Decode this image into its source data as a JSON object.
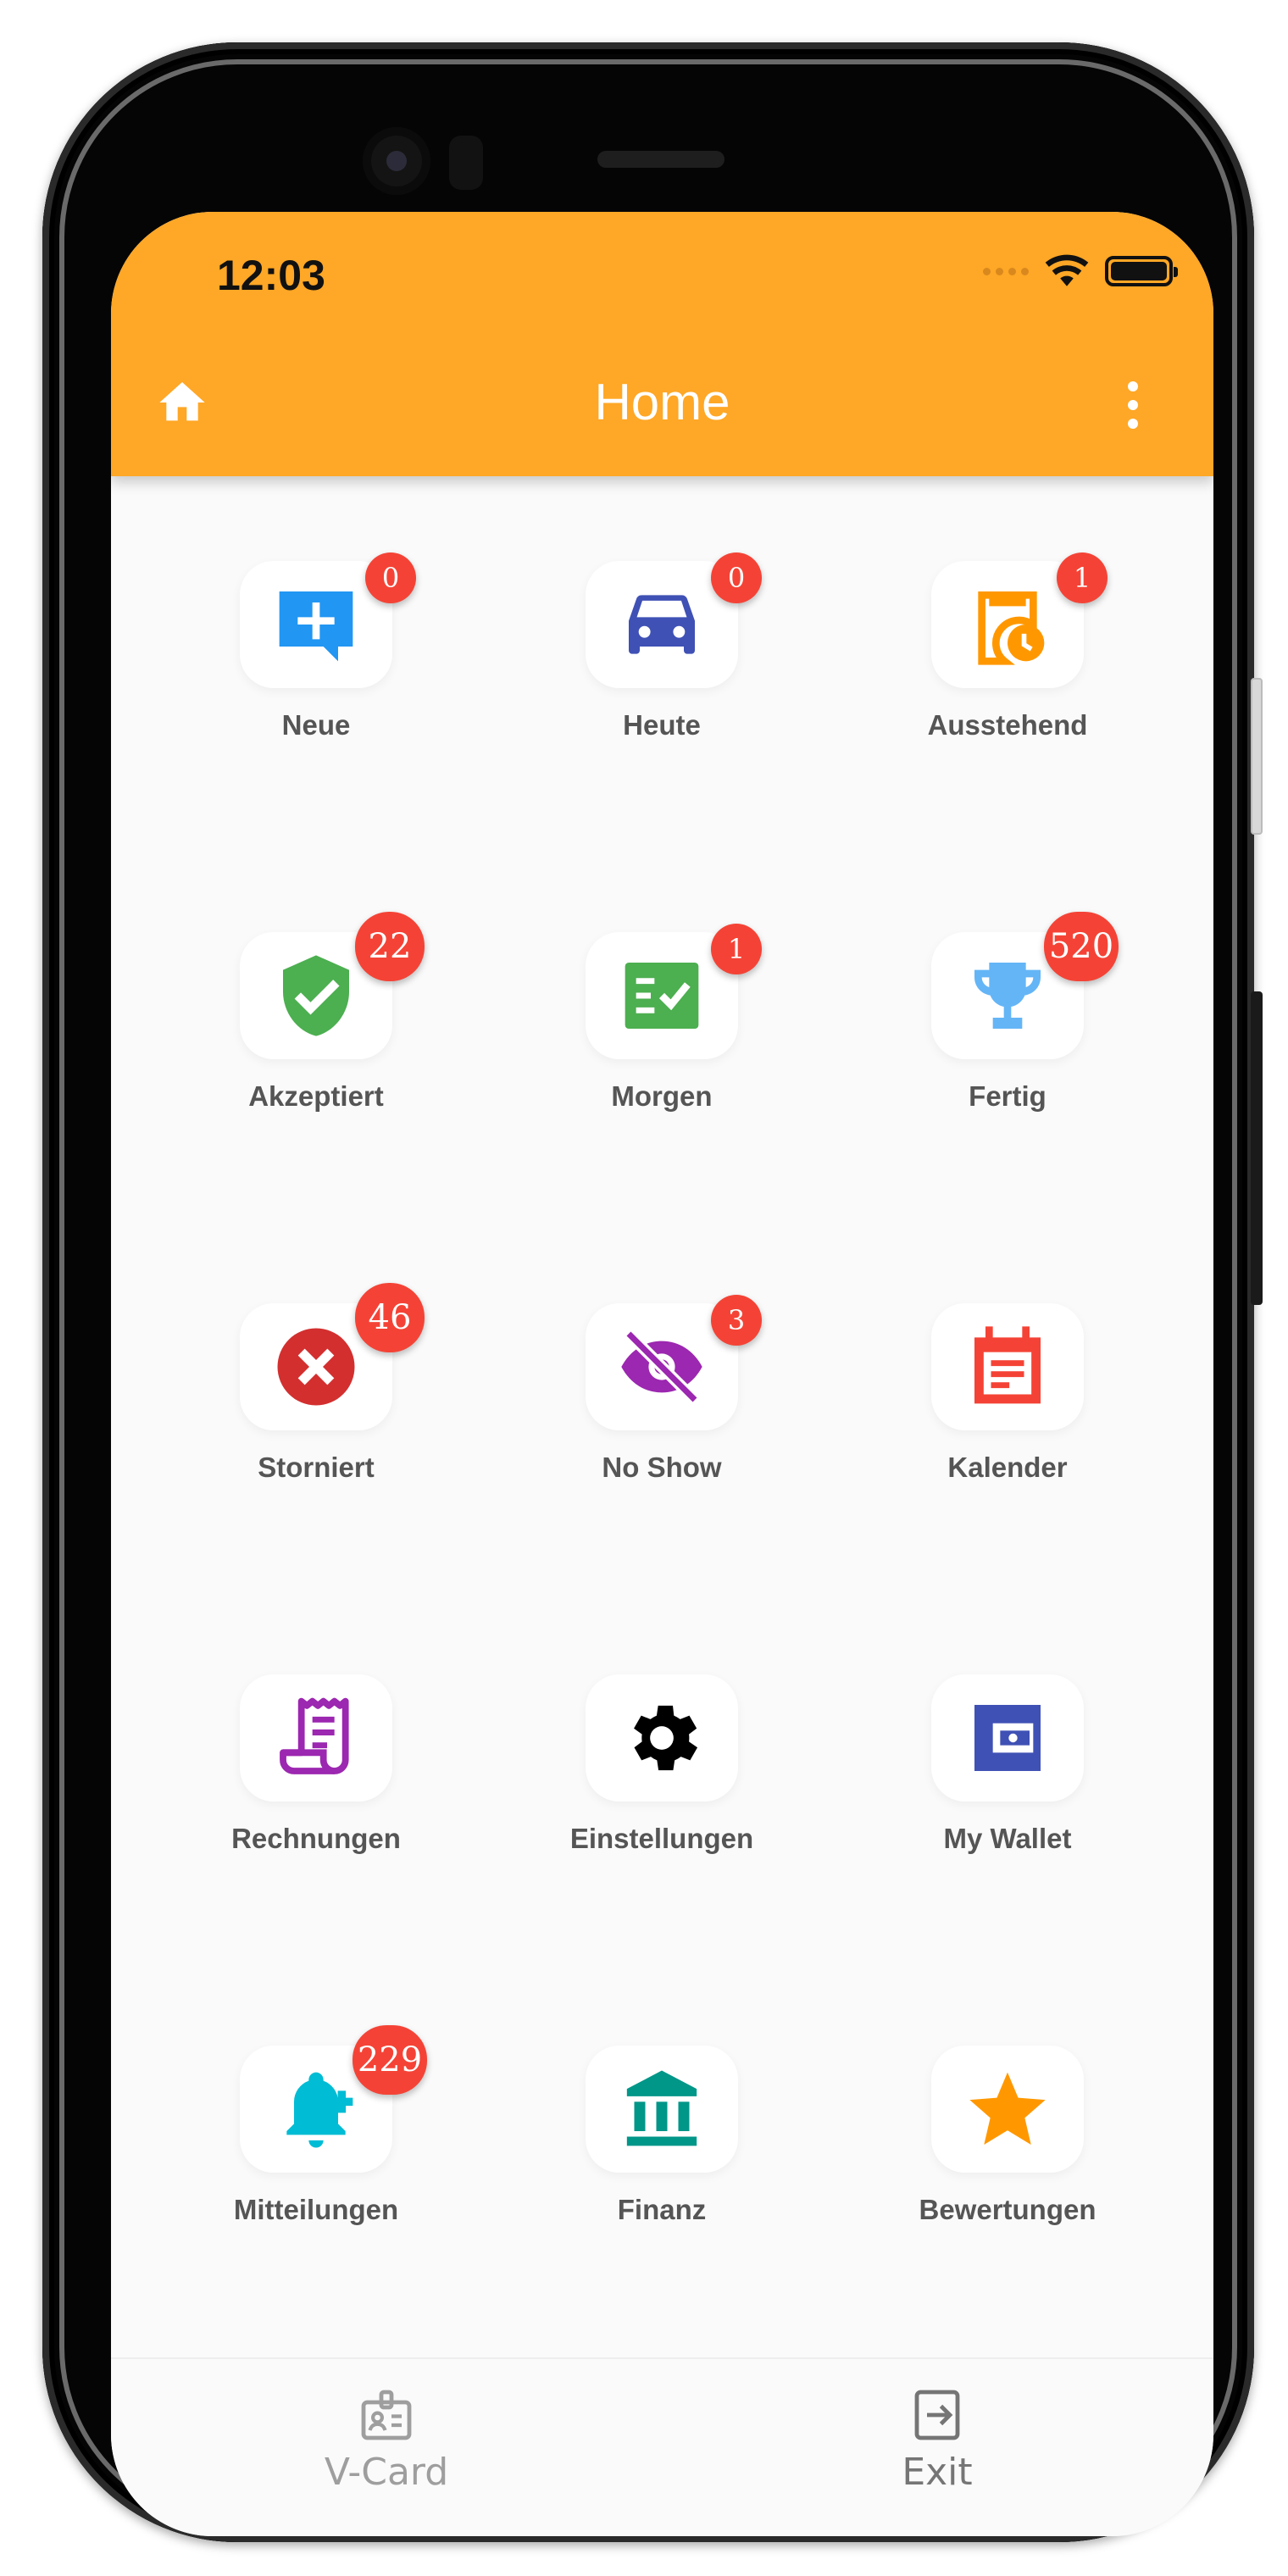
{
  "status_bar": {
    "time": "12:03"
  },
  "app_bar": {
    "title": "Home"
  },
  "tiles": [
    {
      "id": "neue",
      "label": "Neue",
      "badge": "0",
      "icon": "add-comment-icon",
      "color": "#2196f3"
    },
    {
      "id": "heute",
      "label": "Heute",
      "badge": "0",
      "icon": "car-icon",
      "color": "#3f51b5"
    },
    {
      "id": "ausstehend",
      "label": "Ausstehend",
      "badge": "1",
      "icon": "pending-clipboard-icon",
      "color": "#ff9800"
    },
    {
      "id": "akzeptiert",
      "label": "Akzeptiert",
      "badge": "22",
      "icon": "shield-check-icon",
      "color": "#4caf50"
    },
    {
      "id": "morgen",
      "label": "Morgen",
      "badge": "1",
      "icon": "checklist-icon",
      "color": "#4caf50"
    },
    {
      "id": "fertig",
      "label": "Fertig",
      "badge": "520",
      "icon": "trophy-icon",
      "color": "#64b5f6"
    },
    {
      "id": "storniert",
      "label": "Storniert",
      "badge": "46",
      "icon": "cancel-icon",
      "color": "#d32f2f"
    },
    {
      "id": "noshow",
      "label": "No Show",
      "badge": "3",
      "icon": "eye-off-icon",
      "color": "#9c27b0"
    },
    {
      "id": "kalender",
      "label": "Kalender",
      "badge": null,
      "icon": "calendar-icon",
      "color": "#f44336"
    },
    {
      "id": "rechnungen",
      "label": "Rechnungen",
      "badge": null,
      "icon": "receipt-icon",
      "color": "#9c27b0"
    },
    {
      "id": "einstellungen",
      "label": "Einstellungen",
      "badge": null,
      "icon": "gear-icon",
      "color": "#000000"
    },
    {
      "id": "wallet",
      "label": "My Wallet",
      "badge": null,
      "icon": "wallet-icon",
      "color": "#3f51b5"
    },
    {
      "id": "mitteilungen",
      "label": "Mitteilungen",
      "badge": "229",
      "icon": "bell-plus-icon",
      "color": "#00bcd4"
    },
    {
      "id": "finanz",
      "label": "Finanz",
      "badge": null,
      "icon": "bank-icon",
      "color": "#009688"
    },
    {
      "id": "bewertungen",
      "label": "Bewertungen",
      "badge": null,
      "icon": "star-icon",
      "color": "#ff9800"
    }
  ],
  "bottom_nav": {
    "vcard_label": "V-Card",
    "exit_label": "Exit"
  },
  "colors": {
    "app_bar": "#ffa726",
    "badge": "#f44336",
    "background": "#fafafa"
  }
}
